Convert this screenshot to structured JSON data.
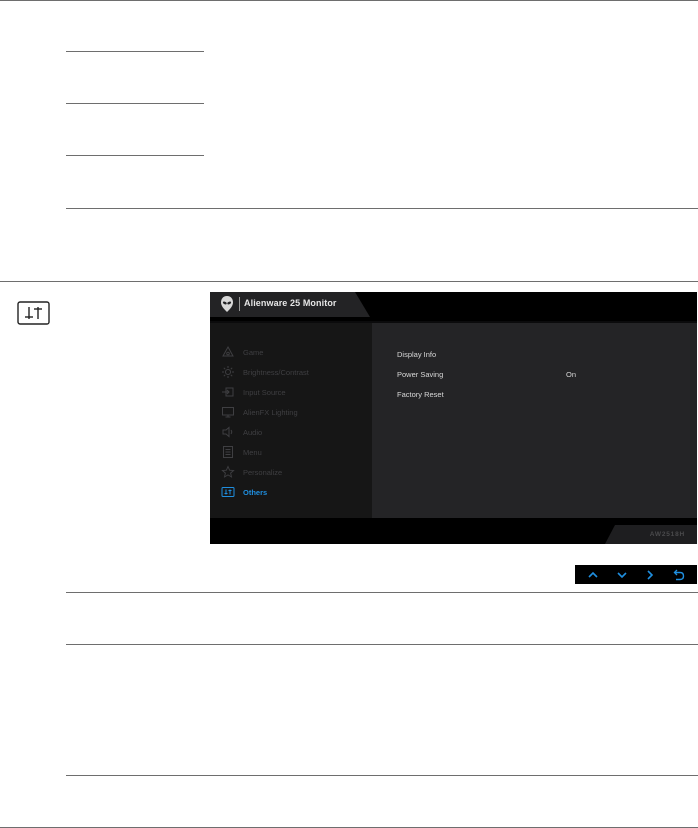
{
  "osd": {
    "title": "Alienware 25 Monitor",
    "model": "AW2518H",
    "menu_items": [
      {
        "icon": "game-icon",
        "label": "Game"
      },
      {
        "icon": "brightness-icon",
        "label": "Brightness/Contrast"
      },
      {
        "icon": "input-source-icon",
        "label": "Input Source"
      },
      {
        "icon": "alienfx-lighting-icon",
        "label": "AlienFX Lighting"
      },
      {
        "icon": "audio-icon",
        "label": "Audio"
      },
      {
        "icon": "menu-icon",
        "label": "Menu"
      },
      {
        "icon": "personalize-icon",
        "label": "Personalize"
      },
      {
        "icon": "others-icon",
        "label": "Others"
      }
    ],
    "active_item": "Others",
    "options": [
      {
        "label": "Display Info",
        "value": ""
      },
      {
        "label": "Power Saving",
        "value": "On"
      },
      {
        "label": "Factory Reset",
        "value": ""
      }
    ]
  },
  "navigation": [
    {
      "icon": "chevron-up-icon"
    },
    {
      "icon": "chevron-down-icon"
    },
    {
      "icon": "chevron-right-icon"
    },
    {
      "icon": "back-icon"
    }
  ],
  "colors": {
    "accent": "#1f8fe0",
    "osd_background": "#0b0b0c",
    "menu_inactive": "#3f3f42"
  }
}
